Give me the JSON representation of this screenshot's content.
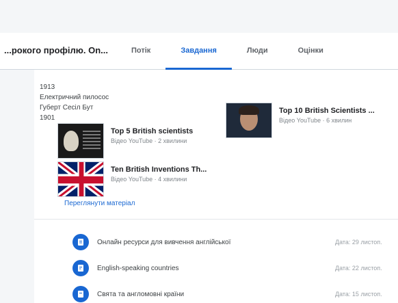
{
  "header": {
    "class_title": "...рокого профілю. On..."
  },
  "tabs": [
    {
      "label": "Потік",
      "active": false
    },
    {
      "label": "Завдання",
      "active": true
    },
    {
      "label": "Люди",
      "active": false
    },
    {
      "label": "Оцінки",
      "active": false
    }
  ],
  "description": {
    "lines": [
      "1913",
      "Електричний пилосос",
      "Губерт Сесіл Бут",
      "1901"
    ]
  },
  "materials": [
    {
      "title": "Top 5 British scientists",
      "subtitle": "Відео YouTube · 2 хвилини",
      "thumb": "portrait-newton"
    },
    {
      "title": "Ten British Inventions Th...",
      "subtitle": "Відео YouTube · 4 хвилини",
      "thumb": "union-jack-flag"
    },
    {
      "title": "Top 10 British Scientists ...",
      "subtitle": "Відео YouTube · 6 хвилин",
      "thumb": "portrait-scientist"
    }
  ],
  "view_material_link": "Переглянути матеріал",
  "topics": [
    {
      "label": "Онлайн ресурси для вивчення англійської",
      "date": "Дата: 29 листоп.",
      "icon": "document-icon"
    },
    {
      "label": "English-speaking countries",
      "date": "Дата: 22 листоп.",
      "icon": "assignment-icon"
    },
    {
      "label": "Свята та англомовні країни",
      "date": "Дата: 15 листоп.",
      "icon": "assignment-icon"
    }
  ],
  "colors": {
    "accent": "#1967d2",
    "flag_blue": "#012169",
    "flag_red": "#c8102e"
  }
}
